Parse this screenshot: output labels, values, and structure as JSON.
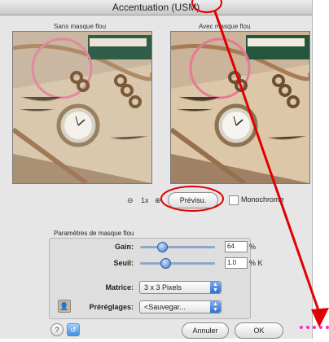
{
  "window": {
    "title": "Accentuation (USM)"
  },
  "previews": {
    "left_caption": "Sans masque flou",
    "right_caption": "Avec masque flou"
  },
  "zoom": {
    "label": "1x"
  },
  "preview_button": {
    "label": "Prévisu."
  },
  "monochrome": {
    "label": "Monochrome",
    "checked": false
  },
  "params": {
    "group_title": "Paramètres de masque flou",
    "gain": {
      "label": "Gain:",
      "value": "64",
      "unit": "%",
      "level": 0.28
    },
    "seuil": {
      "label": "Seuil:",
      "value": "1.0",
      "unit": "% K",
      "level": 0.32
    },
    "matrice": {
      "label": "Matrice:",
      "selected": "3 x 3 Pixels"
    },
    "preglages": {
      "label": "Préréglages:",
      "selected": "<Sauvegar..."
    }
  },
  "buttons": {
    "cancel": "Annuler",
    "ok": "OK"
  },
  "colors": {
    "annotation": "#e00000",
    "accent": "#3f78c8",
    "marker": "#ff2fb0"
  },
  "icons": [
    "zoom-out-icon",
    "zoom-in-icon",
    "preset-portrait-icon",
    "help-icon",
    "reset-icon"
  ]
}
